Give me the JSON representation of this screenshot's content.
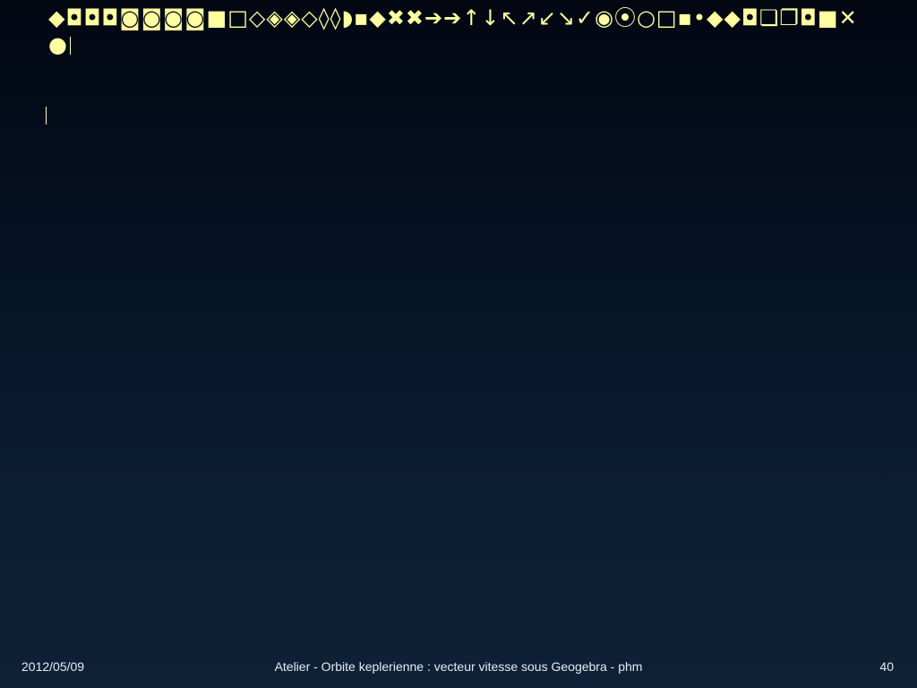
{
  "slide": {
    "title_glyphs": "◆◘◘◘◙◙◙◙■□◇◈◈◇◊◊◗▪◆✖✖➔➔↑↓↖↗↙↘✓◉⦿○□▪•◆◆◘❏❐◘■✕●"
  },
  "footer": {
    "date": "2012/05/09",
    "title": "Atelier - Orbite keplerienne : vecteur vitesse sous Geogebra - phm",
    "page_number": "40"
  }
}
